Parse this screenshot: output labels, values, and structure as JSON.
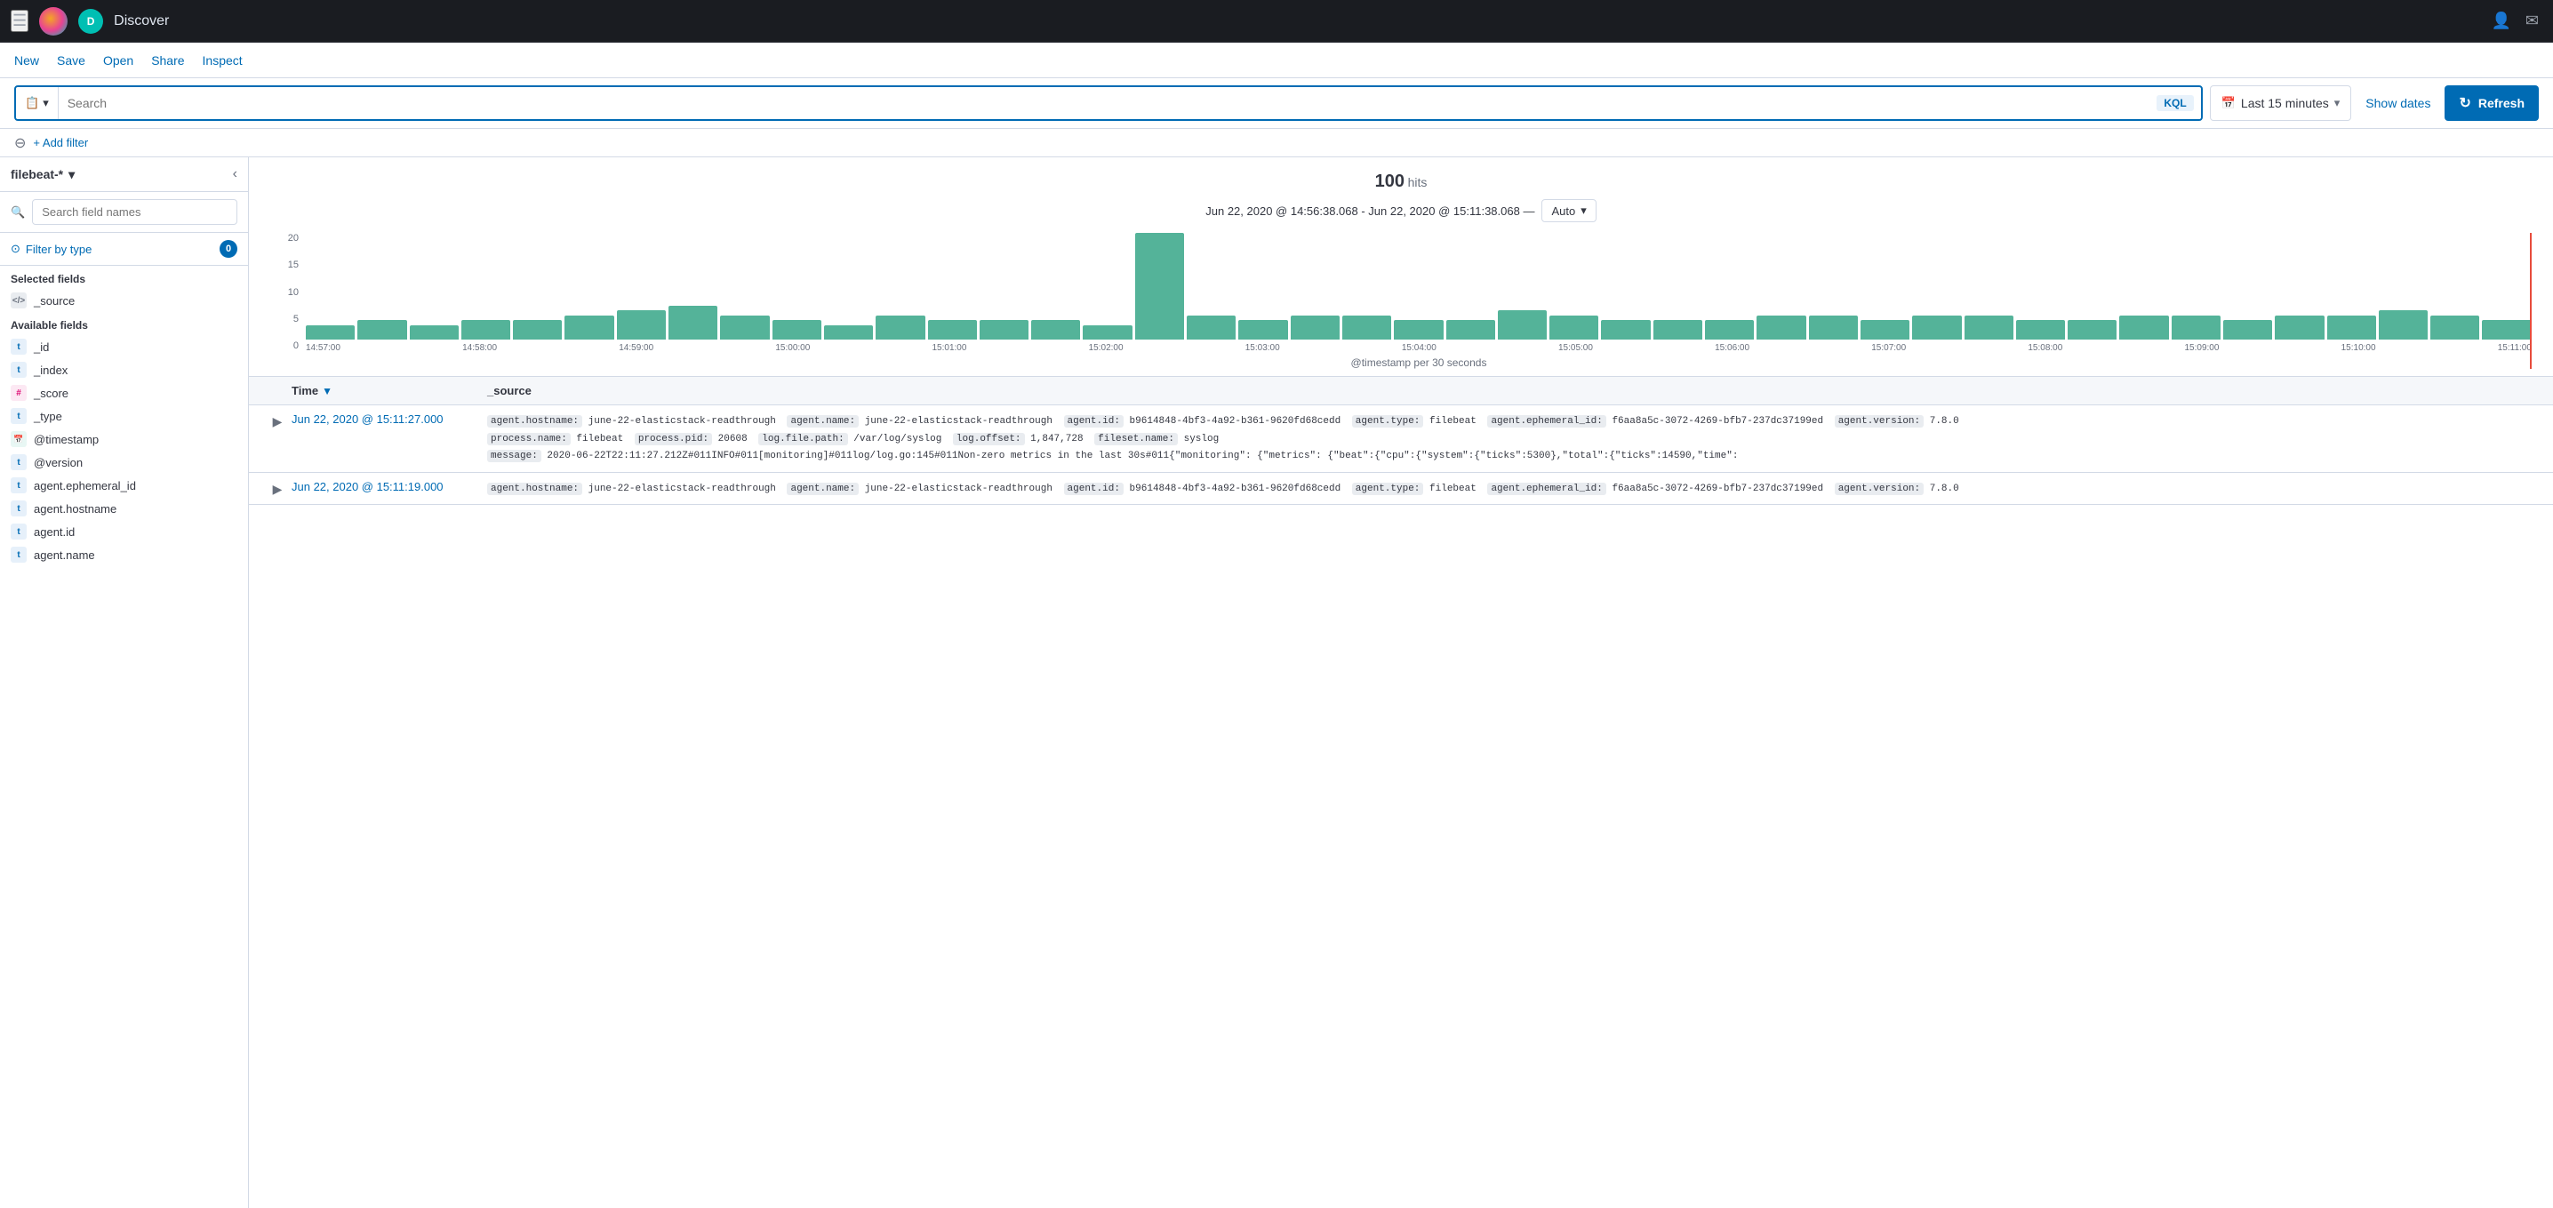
{
  "app": {
    "title": "Discover",
    "user_initial": "D"
  },
  "nav": {
    "new_label": "New",
    "save_label": "Save",
    "open_label": "Open",
    "share_label": "Share",
    "inspect_label": "Inspect"
  },
  "search": {
    "placeholder": "Search",
    "kql_label": "KQL",
    "time_range": "Last 15 minutes",
    "show_dates_label": "Show dates",
    "refresh_label": "Refresh"
  },
  "filter_bar": {
    "add_filter_label": "+ Add filter"
  },
  "sidebar": {
    "index_pattern": "filebeat-*",
    "search_placeholder": "Search field names",
    "filter_type_label": "Filter by type",
    "filter_count": "0",
    "selected_fields_title": "Selected fields",
    "available_fields_title": "Available fields",
    "selected_fields": [
      {
        "name": "_source",
        "type": "source"
      }
    ],
    "available_fields": [
      {
        "name": "_id",
        "type": "t"
      },
      {
        "name": "_index",
        "type": "t"
      },
      {
        "name": "_score",
        "type": "hash"
      },
      {
        "name": "_type",
        "type": "t"
      },
      {
        "name": "@timestamp",
        "type": "calendar"
      },
      {
        "name": "@version",
        "type": "t"
      },
      {
        "name": "agent.ephemeral_id",
        "type": "t"
      },
      {
        "name": "agent.hostname",
        "type": "t"
      },
      {
        "name": "agent.id",
        "type": "t"
      },
      {
        "name": "agent.name",
        "type": "t"
      }
    ]
  },
  "chart": {
    "hits": "100",
    "hits_label": "hits",
    "date_range": "Jun 22, 2020 @ 14:56:38.068 - Jun 22, 2020 @ 15:11:38.068 —",
    "interval_label": "Auto",
    "x_axis_title": "@timestamp per 30 seconds",
    "y_axis_labels": [
      "20",
      "15",
      "10",
      "5",
      "0"
    ],
    "x_axis_labels": [
      "14:57:00",
      "14:58:00",
      "14:59:00",
      "15:00:00",
      "15:01:00",
      "15:02:00",
      "15:03:00",
      "15:04:00",
      "15:05:00",
      "15:06:00",
      "15:07:00",
      "15:08:00",
      "15:09:00",
      "15:10:00",
      "15:11:00"
    ],
    "bars": [
      3,
      4,
      3,
      4,
      4,
      5,
      6,
      7,
      5,
      4,
      3,
      5,
      4,
      4,
      4,
      3,
      22,
      5,
      4,
      5,
      5,
      4,
      4,
      6,
      5,
      4,
      4,
      4,
      5,
      5,
      4,
      5,
      5,
      4,
      4,
      5,
      5,
      4,
      5,
      5,
      6,
      5,
      4
    ]
  },
  "results": {
    "time_col": "Time",
    "source_col": "_source",
    "rows": [
      {
        "time": "Jun 22, 2020 @ 15:11:27.000",
        "source": "agent.hostname: june-22-elasticstack-readthrough  agent.name: june-22-elasticstack-readthrough  agent.id: b9614848-4bf3-4a92-b361-9620fd68cedd  agent.type: filebeat  agent.ephemeral_id: f6aa8a5c-3072-4269-bfb7-237dc37199ed  agent.version: 7.8.0  process.name: filebeat  process.pid: 20608  log.file.path: /var/log/syslog  log.offset: 1,847,728  fileset.name: syslog  message: 2020-06-22T22:11:27.212Z#011INFO#011[monitoring]#011log/log.go:145#011Non-zero metrics in the last 30s#011{\"monitoring\": {\"metrics\": {\"beat\":{\"cpu\":{\"system\":{\"ticks\":5300},\"total\":{\"ticks\":14590,\"time\":"
      },
      {
        "time": "Jun 22, 2020 @ 15:11:19.000",
        "source": "agent.hostname: june-22-elasticstack-readthrough  agent.name: june-22-elasticstack-readthrough  agent.id: b9614848-4bf3-4a92-b361-9620fd68cedd  agent.type: filebeat  agent.ephemeral_id: f6aa8a5c-3072-4269-bfb7-237dc37199ed  agent.version: 7.8.0"
      }
    ]
  }
}
